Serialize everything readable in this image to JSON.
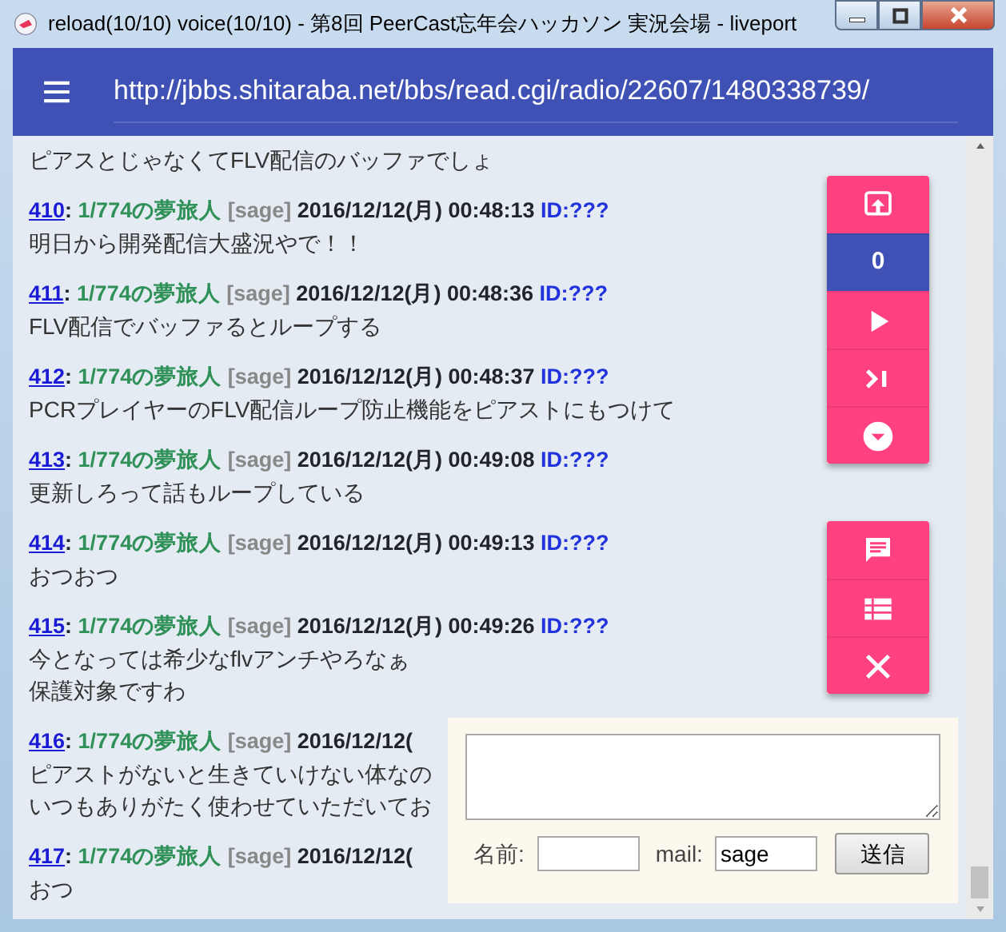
{
  "window": {
    "title": "reload(10/10) voice(10/10) - 第8回 PeerCast忘年会ハッカソン 実況会場 - liveport"
  },
  "header": {
    "url": "http://jbbs.shitaraba.net/bbs/read.cgi/radio/22607/1480338739/"
  },
  "partial_post": {
    "body": [
      "ピアスとじゃなくてFLV配信のバッファでしょ"
    ]
  },
  "posts": [
    {
      "number": "410",
      "separator": ":",
      "name": "1/774の夢旅人",
      "mail": "[sage]",
      "date": "2016/12/12(月) 00:48:13",
      "id": "ID:???",
      "body": [
        "明日から開発配信大盛況やで！！"
      ]
    },
    {
      "number": "411",
      "separator": ":",
      "name": "1/774の夢旅人",
      "mail": "[sage]",
      "date": "2016/12/12(月) 00:48:36",
      "id": "ID:???",
      "body": [
        "FLV配信でバッファるとループする"
      ]
    },
    {
      "number": "412",
      "separator": ":",
      "name": "1/774の夢旅人",
      "mail": "[sage]",
      "date": "2016/12/12(月) 00:48:37",
      "id": "ID:???",
      "body": [
        "PCRプレイヤーのFLV配信ループ防止機能をピアストにもつけて"
      ]
    },
    {
      "number": "413",
      "separator": ":",
      "name": "1/774の夢旅人",
      "mail": "[sage]",
      "date": "2016/12/12(月) 00:49:08",
      "id": "ID:???",
      "body": [
        "更新しろって話もループしている"
      ]
    },
    {
      "number": "414",
      "separator": ":",
      "name": "1/774の夢旅人",
      "mail": "[sage]",
      "date": "2016/12/12(月) 00:49:13",
      "id": "ID:???",
      "body": [
        "おつおつ"
      ]
    },
    {
      "number": "415",
      "separator": ":",
      "name": "1/774の夢旅人",
      "mail": "[sage]",
      "date": "2016/12/12(月) 00:49:26",
      "id": "ID:???",
      "body": [
        "今となっては希少なflvアンチやろなぁ",
        "保護対象ですわ"
      ]
    },
    {
      "number": "416",
      "separator": ":",
      "name": "1/774の夢旅人",
      "mail": "[sage]",
      "date": "2016/12/12(",
      "body": [
        "ピアストがないと生きていけない体なの",
        "いつもありがたく使わせていただいてお"
      ]
    },
    {
      "number": "417",
      "separator": ":",
      "name": "1/774の夢旅人",
      "mail": "[sage]",
      "date": "2016/12/12(",
      "body": [
        "おつ"
      ]
    }
  ],
  "fab_groups": [
    [
      {
        "kind": "scroll-top"
      },
      {
        "kind": "count",
        "label": "0"
      },
      {
        "kind": "play"
      },
      {
        "kind": "skip"
      },
      {
        "kind": "down"
      }
    ],
    [
      {
        "kind": "comment"
      },
      {
        "kind": "list"
      },
      {
        "kind": "close"
      }
    ]
  ],
  "post_form": {
    "name_label": "名前:",
    "mail_label": "mail:",
    "mail_value": "sage",
    "submit": "送信"
  }
}
